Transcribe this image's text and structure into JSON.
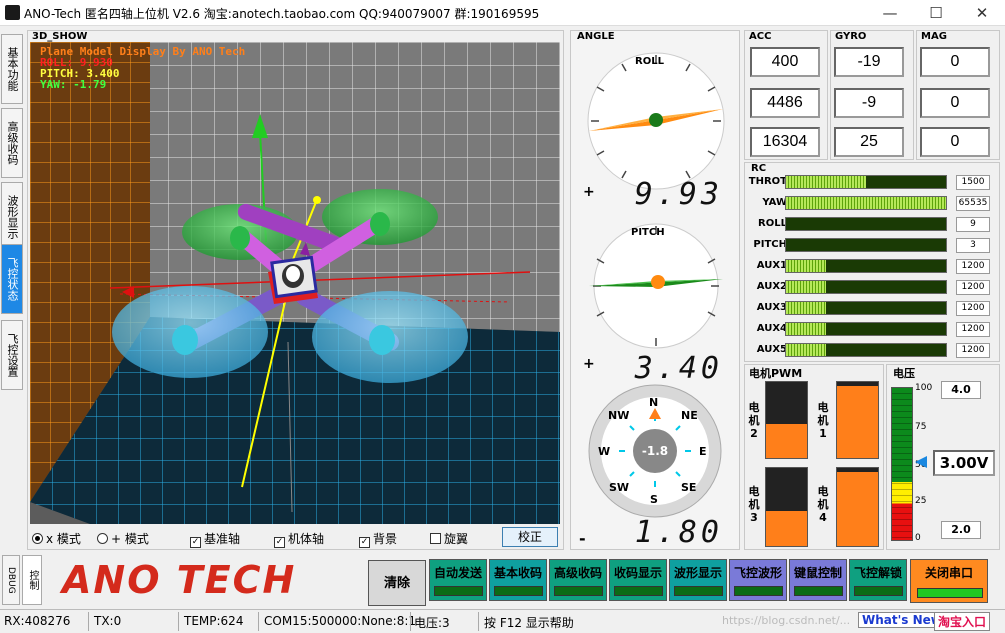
{
  "window": {
    "title": "ANO-Tech   匿名四轴上位机   V2.6   淘宝:anotech.taobao.com   QQ:940079007   群:190169595",
    "minimize": "—",
    "maximize": "☐",
    "close": "✕"
  },
  "left_tabs": [
    "基本功能",
    "高级收码",
    "波形显示",
    "飞控状态",
    "飞控设置"
  ],
  "left_tabs_active": 3,
  "show3d": {
    "title": "3D_SHOW",
    "overlay_title": "Plane Model Display By ANO Tech",
    "roll_line": "ROLL:   9.930",
    "pitch_line": "PITCH:  3.400",
    "yaw_line": "YAW:    -1.79",
    "options": {
      "x_mode": "x 模式",
      "plus_mode": "+ 模式",
      "base_axis": "基准轴",
      "body_axis": "机体轴",
      "background": "背景",
      "rotor": "旋翼",
      "calibrate": "校正"
    }
  },
  "angle": {
    "title": "ANGLE",
    "roll_label": "ROLL",
    "pitch_label": "PITCH",
    "roll_sign": "+",
    "roll_value": "9.93",
    "pitch_sign": "+",
    "pitch_value": "3.40",
    "yaw_sign": "-",
    "yaw_value": "1.80",
    "compass_center": "-1.8",
    "compass": {
      "n": "N",
      "ne": "NE",
      "e": "E",
      "se": "SE",
      "s": "S",
      "sw": "SW",
      "w": "W",
      "nw": "NW"
    }
  },
  "sensors": {
    "acc_title": "ACC",
    "gyro_title": "GYRO",
    "mag_title": "MAG",
    "acc": [
      "400",
      "4486",
      "16304"
    ],
    "gyro": [
      "-19",
      "-9",
      "25"
    ],
    "mag": [
      "0",
      "0",
      "0"
    ]
  },
  "rc": {
    "title": "RC",
    "channels": [
      {
        "label": "THROT",
        "value": "1500",
        "fill": 0.5
      },
      {
        "label": "YAW",
        "value": "65535",
        "fill": 1.0
      },
      {
        "label": "ROLL",
        "value": "9",
        "fill": 0.0
      },
      {
        "label": "PITCH",
        "value": "3",
        "fill": 0.0
      },
      {
        "label": "AUX1",
        "value": "1200",
        "fill": 0.25
      },
      {
        "label": "AUX2",
        "value": "1200",
        "fill": 0.25
      },
      {
        "label": "AUX3",
        "value": "1200",
        "fill": 0.25
      },
      {
        "label": "AUX4",
        "value": "1200",
        "fill": 0.25
      },
      {
        "label": "AUX5",
        "value": "1200",
        "fill": 0.25
      }
    ]
  },
  "motors": {
    "title": "电机PWM",
    "items": [
      {
        "label": "电机2",
        "fill": 0.45
      },
      {
        "label": "电机1",
        "fill": 0.95
      },
      {
        "label": "电机3",
        "fill": 0.45
      },
      {
        "label": "电机4",
        "fill": 0.95
      }
    ]
  },
  "voltage": {
    "title": "电压",
    "ticks": [
      "100",
      "75",
      "50",
      "25",
      "0"
    ],
    "max": "4.0",
    "min": "2.0",
    "value": "3.00V",
    "level": 0.5
  },
  "bottom": {
    "debug_tab": "DBUG",
    "control_tab": "控制",
    "logo": "ANO TECH",
    "clear": "清除",
    "buttons": [
      "自动发送",
      "基本收码",
      "高级收码",
      "收码显示",
      "波形显示",
      "飞控波形",
      "键鼠控制",
      "飞控解锁"
    ],
    "close_port": "关闭串口"
  },
  "status": {
    "rx": "RX:408276",
    "tx": "TX:0",
    "temp": "TEMP:624",
    "com": "COM15:500000:None:8:1",
    "voltage": "电压:3",
    "help": "按 F12 显示帮助",
    "watermark": "https://blog.csdn.net/...",
    "whats_new": "What's New",
    "shop": "淘宝入口"
  },
  "colors": {
    "accent_tab": "#1e88e5",
    "orange": "#ff7f1a",
    "green": "#0b6b16",
    "logo_red": "#d42a1c"
  }
}
